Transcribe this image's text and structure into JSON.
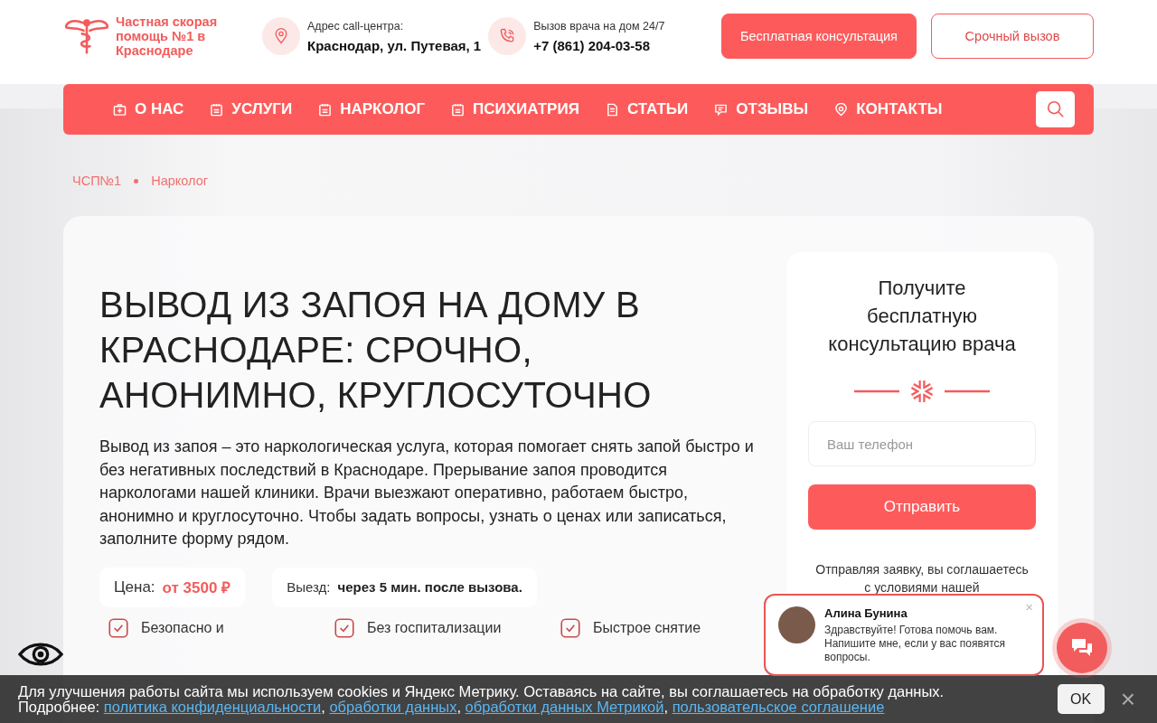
{
  "header": {
    "logo_text": "Частная скорая помощь №1 в Краснодаре",
    "contacts": [
      {
        "kind": "address",
        "label": "Адрес call-центра:",
        "value": "Краснодар, ул. Путевая, 1"
      },
      {
        "kind": "phone",
        "label": "Вызов врача на дом 24/7",
        "value": "+7 (861) 204-03-58"
      }
    ],
    "buttons": [
      {
        "label": "Бесплатная консультация",
        "kind": "primary"
      },
      {
        "label": "Срочный вызов",
        "kind": "outline"
      }
    ]
  },
  "nav": [
    {
      "label": "О НАС",
      "kind": "kit"
    },
    {
      "label": "УСЛУГИ",
      "kind": "list"
    },
    {
      "label": "НАРКОЛОГ",
      "kind": "list"
    },
    {
      "label": "ПСИХИАТРИЯ",
      "kind": "list"
    },
    {
      "label": "СТАТЬИ",
      "kind": "doc"
    },
    {
      "label": "ОТЗЫВЫ",
      "kind": "chat"
    },
    {
      "label": "КОНТАКТЫ",
      "kind": "pin"
    }
  ],
  "breadcrumbs": [
    "ЧСП№1",
    "Нарколог"
  ],
  "hero": {
    "title": "ВЫВОД ИЗ ЗАПОЯ НА ДОМУ В КРАСНОДАРЕ: СРОЧНО, АНОНИМНО, КРУГЛОСУТОЧНО",
    "text": "Вывод из запоя – это наркологическая услуга, которая помогает снять запой быстро и без негативных последствий в Краснодаре. Прерывание запоя проводится наркологами нашей клиники. Врачи выезжают оперативно, работаем быстро, анонимно и круглосуточно. Чтобы задать вопросы, узнать о ценах или записаться, заполните форму рядом.",
    "price_label": "Цена:",
    "price_value": "от 3500 ₽",
    "departure_label": "Выезд:",
    "departure_value": "через 5 мин. после вызова.",
    "features": [
      "Безопасно и",
      "Без госпитализации",
      "Быстрое снятие"
    ]
  },
  "form": {
    "title": "Получите бесплатную консультацию врача",
    "placeholder": "Ваш телефон",
    "submit": "Отправить",
    "note": "Отправляя заявку, вы соглашаетесь с условиями нашей"
  },
  "cookie": {
    "text": "Для улучшения работы сайта мы используем cookies и Яндекс Метрику. Оставаясь на сайте, вы соглашаетесь на обработку данных.",
    "more": "Подробнее:",
    "links": [
      "политика конфиденциальности",
      "обработки данных",
      "обработки данных Метрикой",
      "пользовательское соглашение"
    ],
    "separator": ",",
    "ok": "OK",
    "close": "×"
  },
  "chat": {
    "name": "Алина Бунина",
    "message": "Здравствуйте! Готова помочь вам. Напишите мне, если у вас появятся вопросы.",
    "close": "×"
  }
}
